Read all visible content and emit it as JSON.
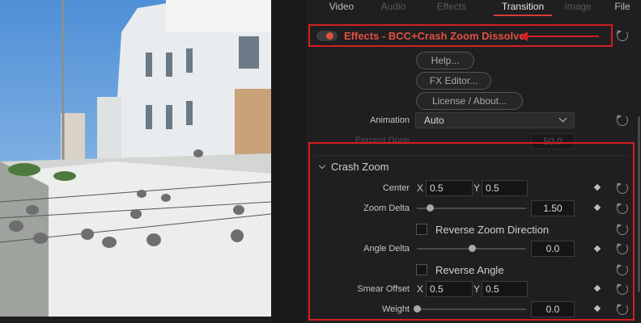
{
  "tabs": [
    {
      "label": "Video",
      "state": "normal"
    },
    {
      "label": "Audio",
      "state": "disabled"
    },
    {
      "label": "Effects",
      "state": "disabled"
    },
    {
      "label": "Transition",
      "state": "active"
    },
    {
      "label": "Image",
      "state": "disabled"
    },
    {
      "label": "File",
      "state": "normal"
    }
  ],
  "effect": {
    "title": "Effects - BCC+Crash Zoom Dissolve",
    "enabled": true,
    "buttons": {
      "help": "Help...",
      "fx_editor": "FX Editor...",
      "license": "License / About..."
    }
  },
  "animation": {
    "label": "Animation",
    "value": "Auto"
  },
  "percent_done": {
    "label": "Percent Done",
    "value": "50.0"
  },
  "crash_zoom": {
    "section_title": "Crash Zoom",
    "center": {
      "label": "Center",
      "x_label": "X",
      "x": "0.5",
      "y_label": "Y",
      "y": "0.5"
    },
    "zoom_delta": {
      "label": "Zoom Delta",
      "value": "1.50",
      "fraction": 0.12
    },
    "reverse_zoom": {
      "label": "Reverse Zoom Direction",
      "checked": false
    },
    "angle_delta": {
      "label": "Angle Delta",
      "value": "0.0",
      "fraction": 0.5
    },
    "reverse_angle": {
      "label": "Reverse Angle",
      "checked": false
    },
    "smear_offset": {
      "label": "Smear Offset",
      "x_label": "X",
      "x": "0.5",
      "y_label": "Y",
      "y": "0.5"
    },
    "weight": {
      "label": "Weight",
      "value": "0.0",
      "fraction": 0.0
    }
  },
  "colors": {
    "accent_red": "#d41f1f",
    "effect_title": "#e2513f"
  },
  "icons": [
    "toggle-switch",
    "reset-icon",
    "keyframe-diamond-icon",
    "chevron-down-icon"
  ]
}
